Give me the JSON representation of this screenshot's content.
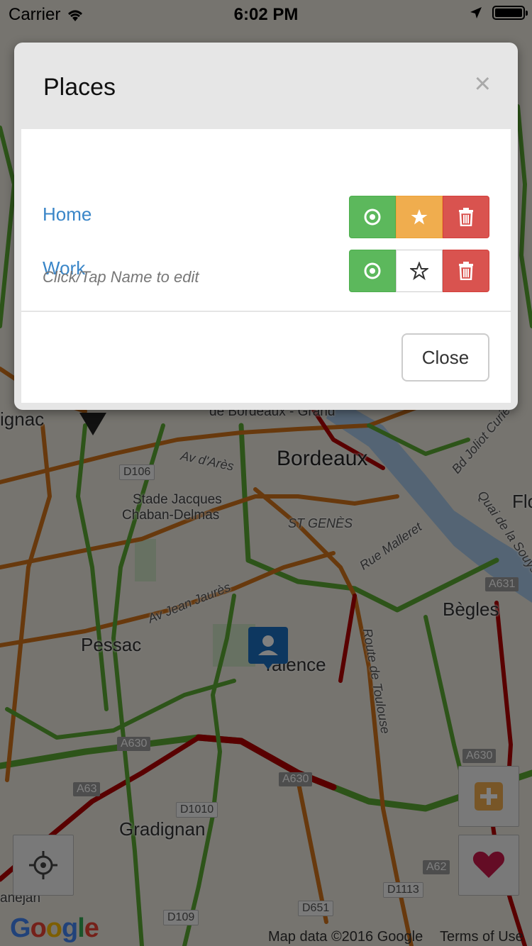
{
  "status_bar": {
    "carrier": "Carrier",
    "time": "6:02 PM"
  },
  "map": {
    "labels": {
      "bordeaux": "Bordeaux",
      "stade_line1": "Stade Jacques",
      "stade_line2": "Chaban-Delmas",
      "st_genes": "ST GENÈS",
      "begles": "Bègles",
      "pessac": "Pessac",
      "talence": "Talence",
      "gradignan": "Gradignan",
      "gare": "de Bordeaux - Grand",
      "ignac": "ignac",
      "flo": "Flo",
      "anejan": "anejan",
      "av_ares": "Av d'Arès",
      "av_jean_jaures": "Av Jean Jaurès",
      "route_toulouse": "Route de Toulouse",
      "rue_malleret": "Rue Malleret",
      "quai_souys": "Quai de la Souys",
      "bd_joliot": "Bd Joliot Curie"
    },
    "shields": {
      "d106": "D106",
      "a630_1": "A630",
      "a630_2": "A630",
      "a630_3": "A630",
      "a631": "A631",
      "a63": "A63",
      "a62": "A62",
      "d1010": "D1010",
      "d1113": "D1113",
      "d651": "D651",
      "d109": "D109"
    },
    "google_logo": "Google",
    "attribution": "Map data ©2016 Google",
    "terms": "Terms of Use",
    "colors": {
      "traffic_green": "#5aa832",
      "traffic_orange": "#d0731a",
      "traffic_red": "#b30000"
    }
  },
  "modal": {
    "title": "Places",
    "close_x": "×",
    "places": [
      {
        "name": "Home",
        "favorite": true
      },
      {
        "name": "Work",
        "favorite": false
      }
    ],
    "hint": "Click/Tap Name to edit",
    "close_button": "Close",
    "icons": {
      "locate": "target-icon",
      "favorite": "star-icon",
      "delete": "trash-icon"
    },
    "colors": {
      "green": "#5cb85c",
      "orange": "#f0ad4e",
      "red": "#d9534f",
      "link": "#3a86c8"
    }
  },
  "controls": {
    "locate": "crosshair-icon",
    "add": "plus-icon",
    "favorite": "heart-icon"
  }
}
